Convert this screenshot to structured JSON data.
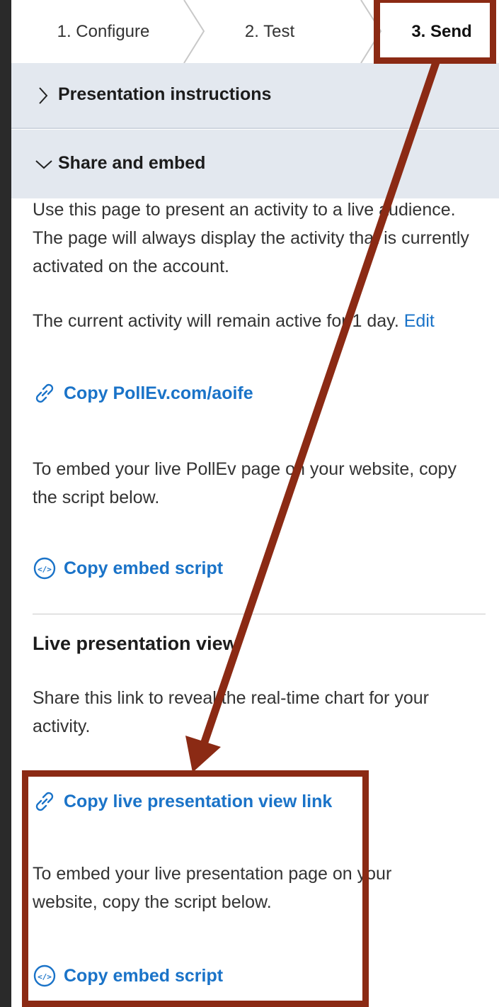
{
  "stepper": {
    "steps": [
      {
        "label": "1. Configure"
      },
      {
        "label": "2. Test"
      },
      {
        "label": "3. Send"
      }
    ]
  },
  "accordion": {
    "presentation_instructions": "Presentation instructions",
    "share_and_embed": "Share and embed"
  },
  "share": {
    "intro": "Use this page to present an activity to a live audience. The page will always display the activity that is currently activated on the account.",
    "active_text": "The current activity will remain active for 1 day.",
    "edit_label": "Edit",
    "copy_link_label": "Copy PollEv.com/aoife",
    "embed_text": "To embed your live PollEv page on your website, copy the script below.",
    "copy_embed_label": "Copy embed script"
  },
  "live": {
    "heading": "Live presentation view",
    "description": "Share this link to reveal the real-time chart for your activity.",
    "copy_link_label": "Copy live presentation view link",
    "embed_text": "To embed your live presentation page on your website, copy the script below.",
    "copy_embed_label": "Copy embed script"
  },
  "icons": {
    "link": "link-icon",
    "embed": "code-embed-icon",
    "chevron_right": "chevron-right-icon",
    "chevron_down": "chevron-down-icon"
  },
  "colors": {
    "link": "#1a73c8",
    "accordion_bg": "#e3e8ef",
    "annotation": "#8b2a14",
    "backdrop": "#2a2a2a"
  }
}
